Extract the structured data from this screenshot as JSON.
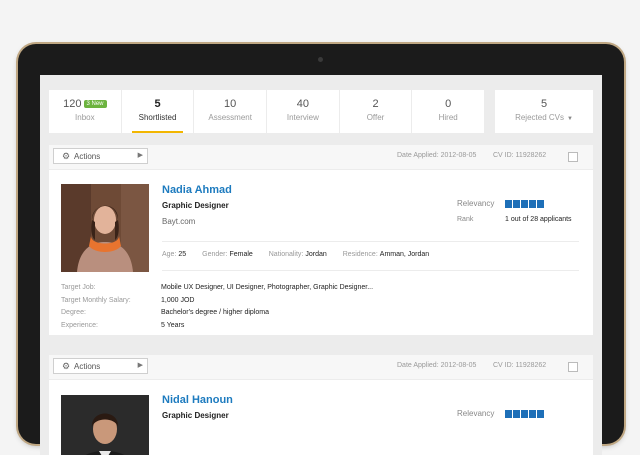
{
  "tabs": [
    {
      "count": "120",
      "label": "Inbox",
      "badge": "3 New"
    },
    {
      "count": "5",
      "label": "Shortlisted",
      "active": true
    },
    {
      "count": "10",
      "label": "Assessment"
    },
    {
      "count": "40",
      "label": "Interview"
    },
    {
      "count": "2",
      "label": "Offer"
    },
    {
      "count": "0",
      "label": "Hired"
    }
  ],
  "rejected": {
    "count": "5",
    "label": "Rejected CVs"
  },
  "accent_color": "#f2b600",
  "link_color": "#1d7bbf",
  "candidates": [
    {
      "actions_label": "Actions",
      "date_applied": "Date Applied: 2012-08-05",
      "cv_id": "CV ID: 11928262",
      "name": "Nadia Ahmad",
      "job": "Graphic Designer",
      "company": "Bayt.com",
      "relevancy_label": "Relevancy",
      "relevancy_score": 5,
      "rank_label": "Rank",
      "rank_value": "1 out of 28 applicants",
      "facts": {
        "age_label": "Age:",
        "age": "25",
        "gender_label": "Gender:",
        "gender": "Female",
        "nationality_label": "Nationality:",
        "nationality": "Jordan",
        "residence_label": "Residence:",
        "residence": "Amman, Jordan"
      },
      "details": [
        {
          "k": "Target Job:",
          "v": "Mobile UX Designer, UI Designer, Photographer, Graphic Designer..."
        },
        {
          "k": "Target Monthly Salary:",
          "v": "1,000 JOD"
        },
        {
          "k": "Degree:",
          "v": "Bachelor's degree / higher diploma"
        },
        {
          "k": "Experience:",
          "v": "5 Years"
        }
      ]
    },
    {
      "actions_label": "Actions",
      "date_applied": "Date Applied: 2012-08-05",
      "cv_id": "CV ID: 11928262",
      "name": "Nidal Hanoun",
      "job": "Graphic Designer",
      "relevancy_label": "Relevancy",
      "relevancy_score": 5
    }
  ]
}
